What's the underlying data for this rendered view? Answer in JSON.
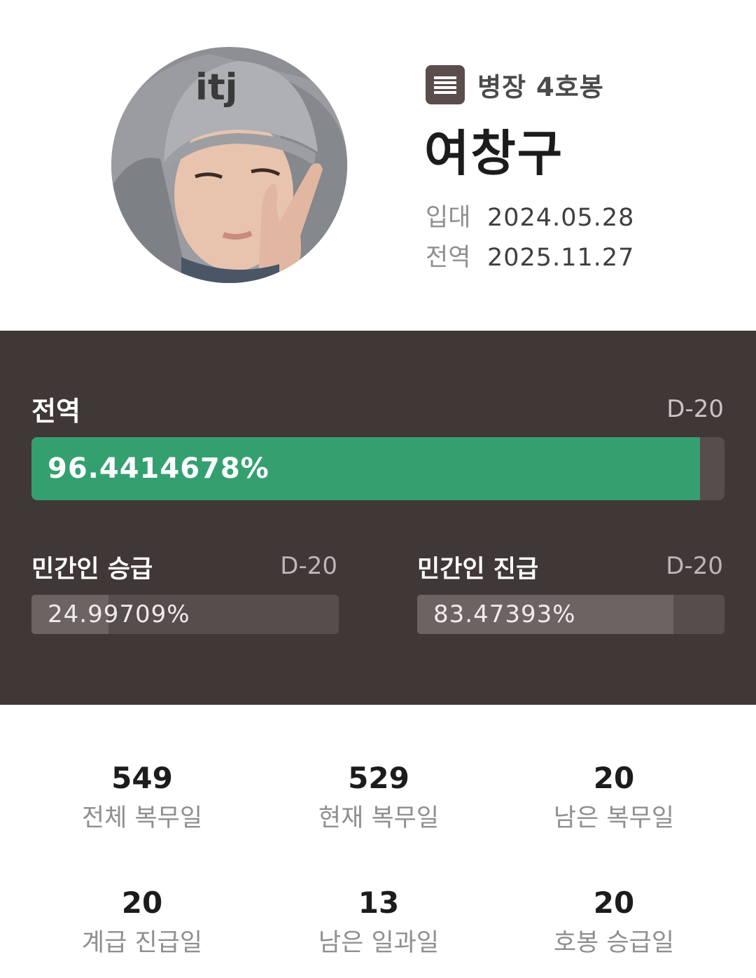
{
  "profile": {
    "rank": "병장 4호봉",
    "rank_icon": "list-icon",
    "name": "여창구",
    "enlist_label": "입대",
    "enlist_date": "2024.05.28",
    "discharge_label": "전역",
    "discharge_date": "2025.11.27"
  },
  "progress": {
    "main": {
      "title": "전역",
      "dday": "D-20",
      "percent_text": "96.4414678%",
      "fraction": 0.964414678
    },
    "civilian_promotion": {
      "title": "민간인 승급",
      "dday": "D-20",
      "percent_text": "24.99709%",
      "fraction": 0.2499709
    },
    "civilian_advance": {
      "title": "민간인 진급",
      "dday": "D-20",
      "percent_text": "83.47393%",
      "fraction": 0.8347393
    }
  },
  "stats": [
    {
      "value": "549",
      "label": "전체 복무일"
    },
    {
      "value": "529",
      "label": "현재 복무일"
    },
    {
      "value": "20",
      "label": "남은 복무일"
    },
    {
      "value": "20",
      "label": "계급 진급일"
    },
    {
      "value": "13",
      "label": "남은 일과일"
    },
    {
      "value": "20",
      "label": "호봉 승급일"
    }
  ],
  "colors": {
    "panel_bg": "#403737",
    "bar_track": "#574d4c",
    "main_fill": "#34a070",
    "sub_fill": "#6d6362",
    "rank_icon_bg": "#5a4d4c"
  }
}
